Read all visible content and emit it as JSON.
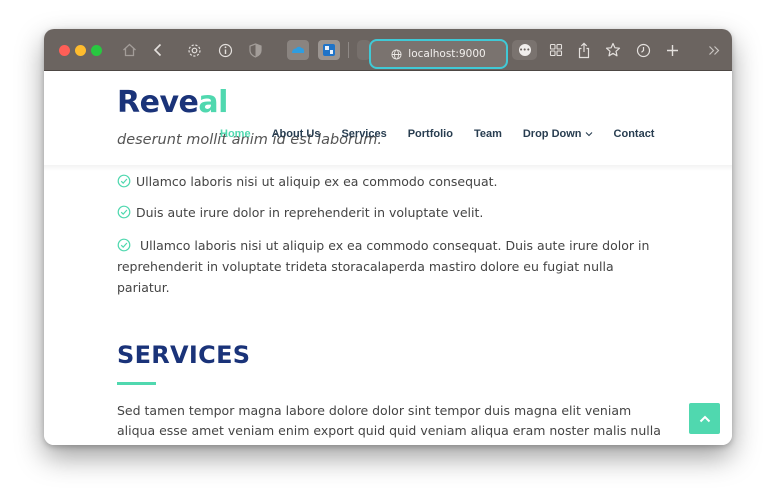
{
  "browser": {
    "url": "localhost:9000",
    "icons": [
      "home-icon",
      "back-icon",
      "settings-icon",
      "info-icon",
      "shield-icon",
      "cloud-extension-icon",
      "blue-extension-icon",
      "more-icon",
      "tab-overview-icon",
      "share-icon",
      "bookmark-star-icon",
      "history-clock-icon",
      "new-tab-plus-icon",
      "chevron-double-right-icon"
    ],
    "traffic_lights": {
      "red": "#fe5f57",
      "yellow": "#febc2e",
      "green": "#28c840"
    },
    "url_focus_color": "#40c9d6"
  },
  "site": {
    "logo_main": "Reve",
    "logo_accent": "al",
    "brand_color": "#1a3379",
    "accent_color": "#50d8af",
    "nav": [
      {
        "label": "Home",
        "active": true
      },
      {
        "label": "About Us"
      },
      {
        "label": "Services"
      },
      {
        "label": "Portfolio"
      },
      {
        "label": "Team"
      },
      {
        "label": "Drop Down"
      },
      {
        "label": "Contact"
      }
    ]
  },
  "about": {
    "intro_fragment": "deserunt mollit anim id est laborum.",
    "checks": [
      "Ullamco laboris nisi ut aliquip ex ea commodo consequat.",
      "Duis aute irure dolor in reprehenderit in voluptate velit.",
      "Ullamco laboris nisi ut aliquip ex ea commodo consequat. Duis aute irure dolor in reprehenderit in voluptate trideta storacalaperda mastiro dolore eu fugiat nulla pariatur."
    ]
  },
  "services": {
    "title": "SERVICES",
    "description": "Sed tamen tempor magna labore dolore dolor sint tempor duis magna elit veniam aliqua esse amet veniam enim export quid quid veniam aliqua eram noster malis nulla duis fugiat culpa esse aute nulla ipsum velit export irure minim illum fore"
  }
}
